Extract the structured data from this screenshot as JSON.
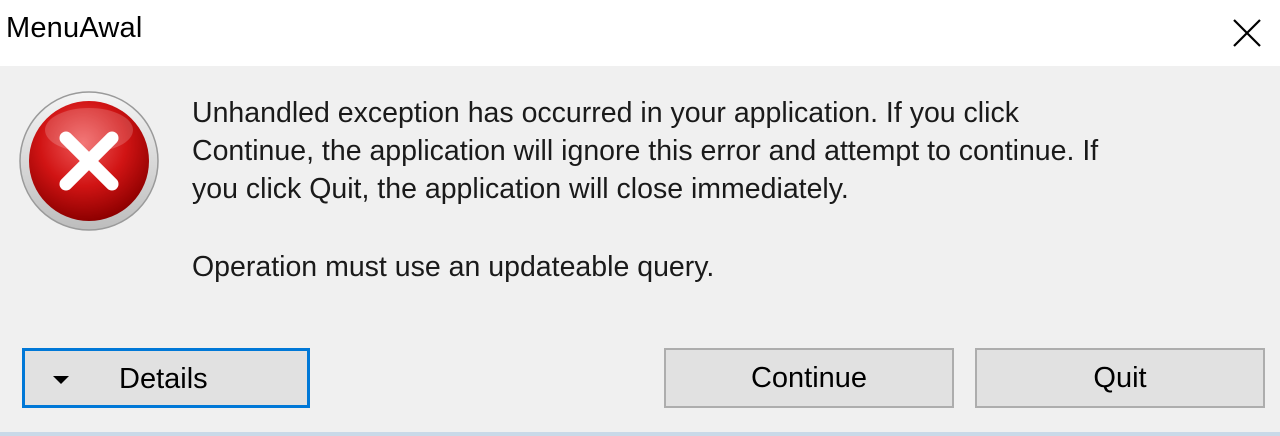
{
  "window": {
    "title": "MenuAwal"
  },
  "icons": {
    "close": "close-icon",
    "error": "error-icon",
    "details_arrow": "triangle-down-icon"
  },
  "message": {
    "line1": "Unhandled exception has occurred in your application. If you click",
    "line2": "Continue, the application will ignore this error and attempt to continue. If",
    "line3": "you click Quit, the application will close immediately.",
    "error_detail": "Operation must use an updateable query."
  },
  "buttons": {
    "details_label": "Details",
    "continue_label": "Continue",
    "quit_label": "Quit"
  },
  "colors": {
    "focus_border": "#0078d7",
    "error_red": "#c40000",
    "background": "#f0f0f0"
  }
}
